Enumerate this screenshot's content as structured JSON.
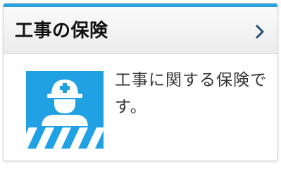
{
  "card": {
    "title": "工事の保険",
    "description": "工事に関する保険です。",
    "icon": "construction-worker-icon",
    "chevron_icon": "chevron-right-icon"
  },
  "colors": {
    "accent": "#2aa2de",
    "icon_bg": "#1fa1e3",
    "chevron": "#1f4e79"
  }
}
